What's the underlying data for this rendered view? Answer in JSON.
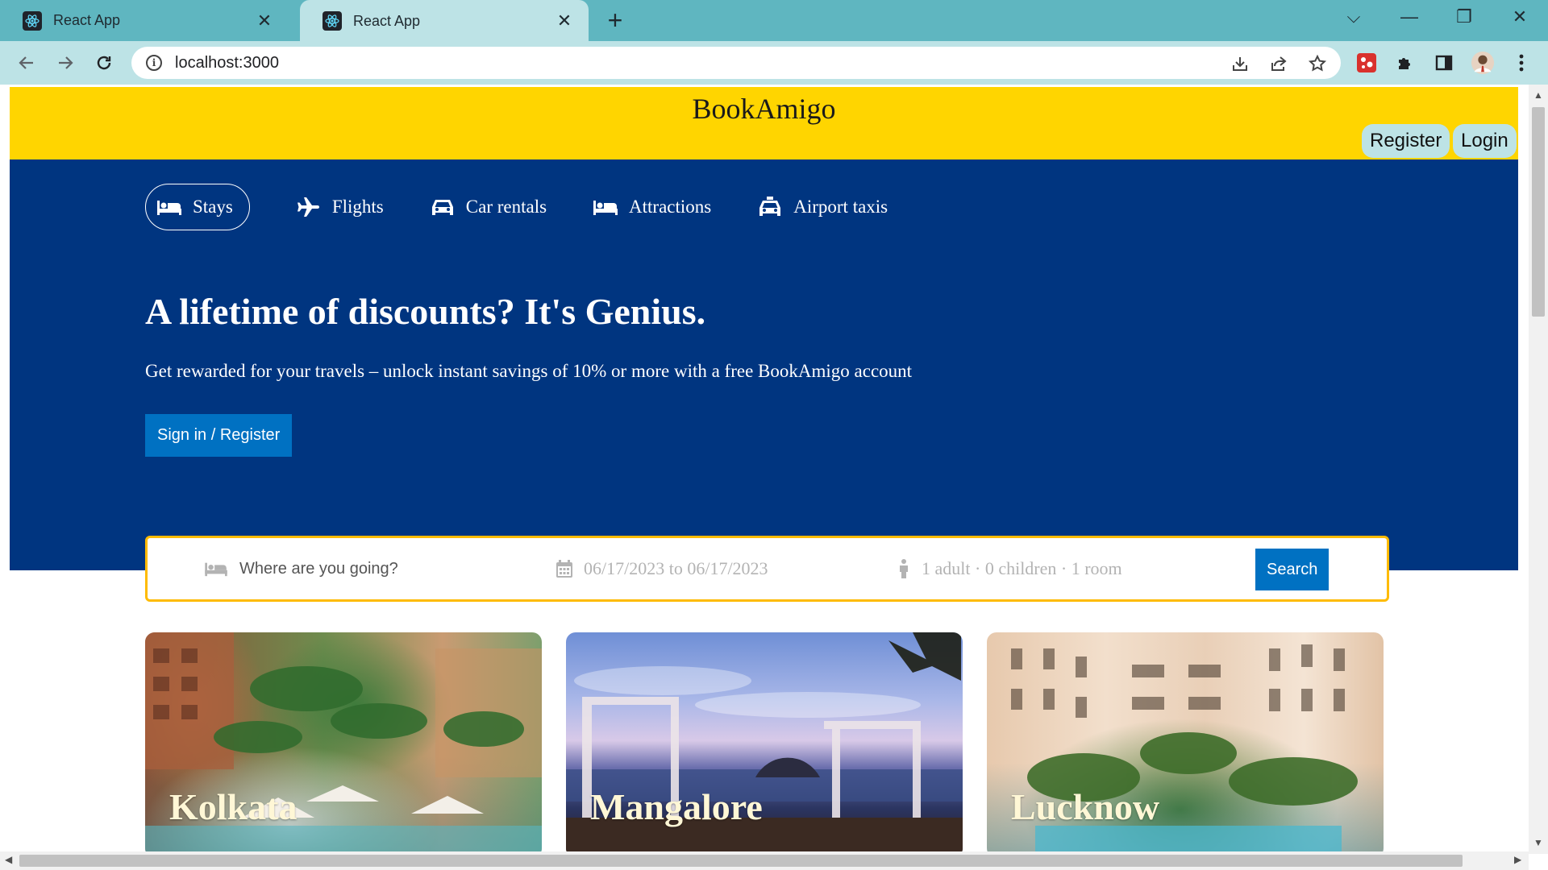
{
  "browser": {
    "tabs": [
      {
        "title": "React App",
        "close": "✕"
      },
      {
        "title": "React App",
        "close": "✕"
      }
    ],
    "new_tab": "+",
    "window_controls": {
      "list": "⌵",
      "minimize": "—",
      "restore": "❐",
      "close": "✕"
    },
    "url": "localhost:3000",
    "icons": [
      "back-arrow-icon",
      "forward-arrow-icon",
      "reload-icon",
      "site-info-icon",
      "install-icon",
      "share-icon",
      "bookmark-star-icon",
      "extension-red-icon",
      "puzzle-icon",
      "sidepanel-icon",
      "profile-avatar",
      "kebab-menu-icon"
    ]
  },
  "header": {
    "logo": "BookAmigo",
    "register": "Register",
    "login": "Login"
  },
  "nav": {
    "items": [
      {
        "label": "Stays",
        "icon": "bed-icon",
        "active": true
      },
      {
        "label": "Flights",
        "icon": "plane-icon",
        "active": false
      },
      {
        "label": "Car rentals",
        "icon": "car-icon",
        "active": false
      },
      {
        "label": "Attractions",
        "icon": "bed-icon",
        "active": false
      },
      {
        "label": "Airport taxis",
        "icon": "taxi-icon",
        "active": false
      }
    ]
  },
  "hero": {
    "title": "A lifetime of discounts? It's Genius.",
    "description": "Get rewarded for your travels – unlock instant savings of 10% or more with a free BookAmigo account",
    "cta": "Sign in / Register"
  },
  "search": {
    "destination_placeholder": "Where are you going?",
    "dates": "06/17/2023 to 06/17/2023",
    "guests": "1 adult · 0 children · 1 room",
    "button": "Search"
  },
  "featured": [
    {
      "city": "Kolkata"
    },
    {
      "city": "Mangalore"
    },
    {
      "city": "Lucknow"
    }
  ],
  "colors": {
    "header_bg": "#ffd500",
    "hero_bg": "#003580",
    "button_blue": "#0071c2",
    "search_border": "#febb02",
    "tabstrip": "#5fb6c0"
  }
}
